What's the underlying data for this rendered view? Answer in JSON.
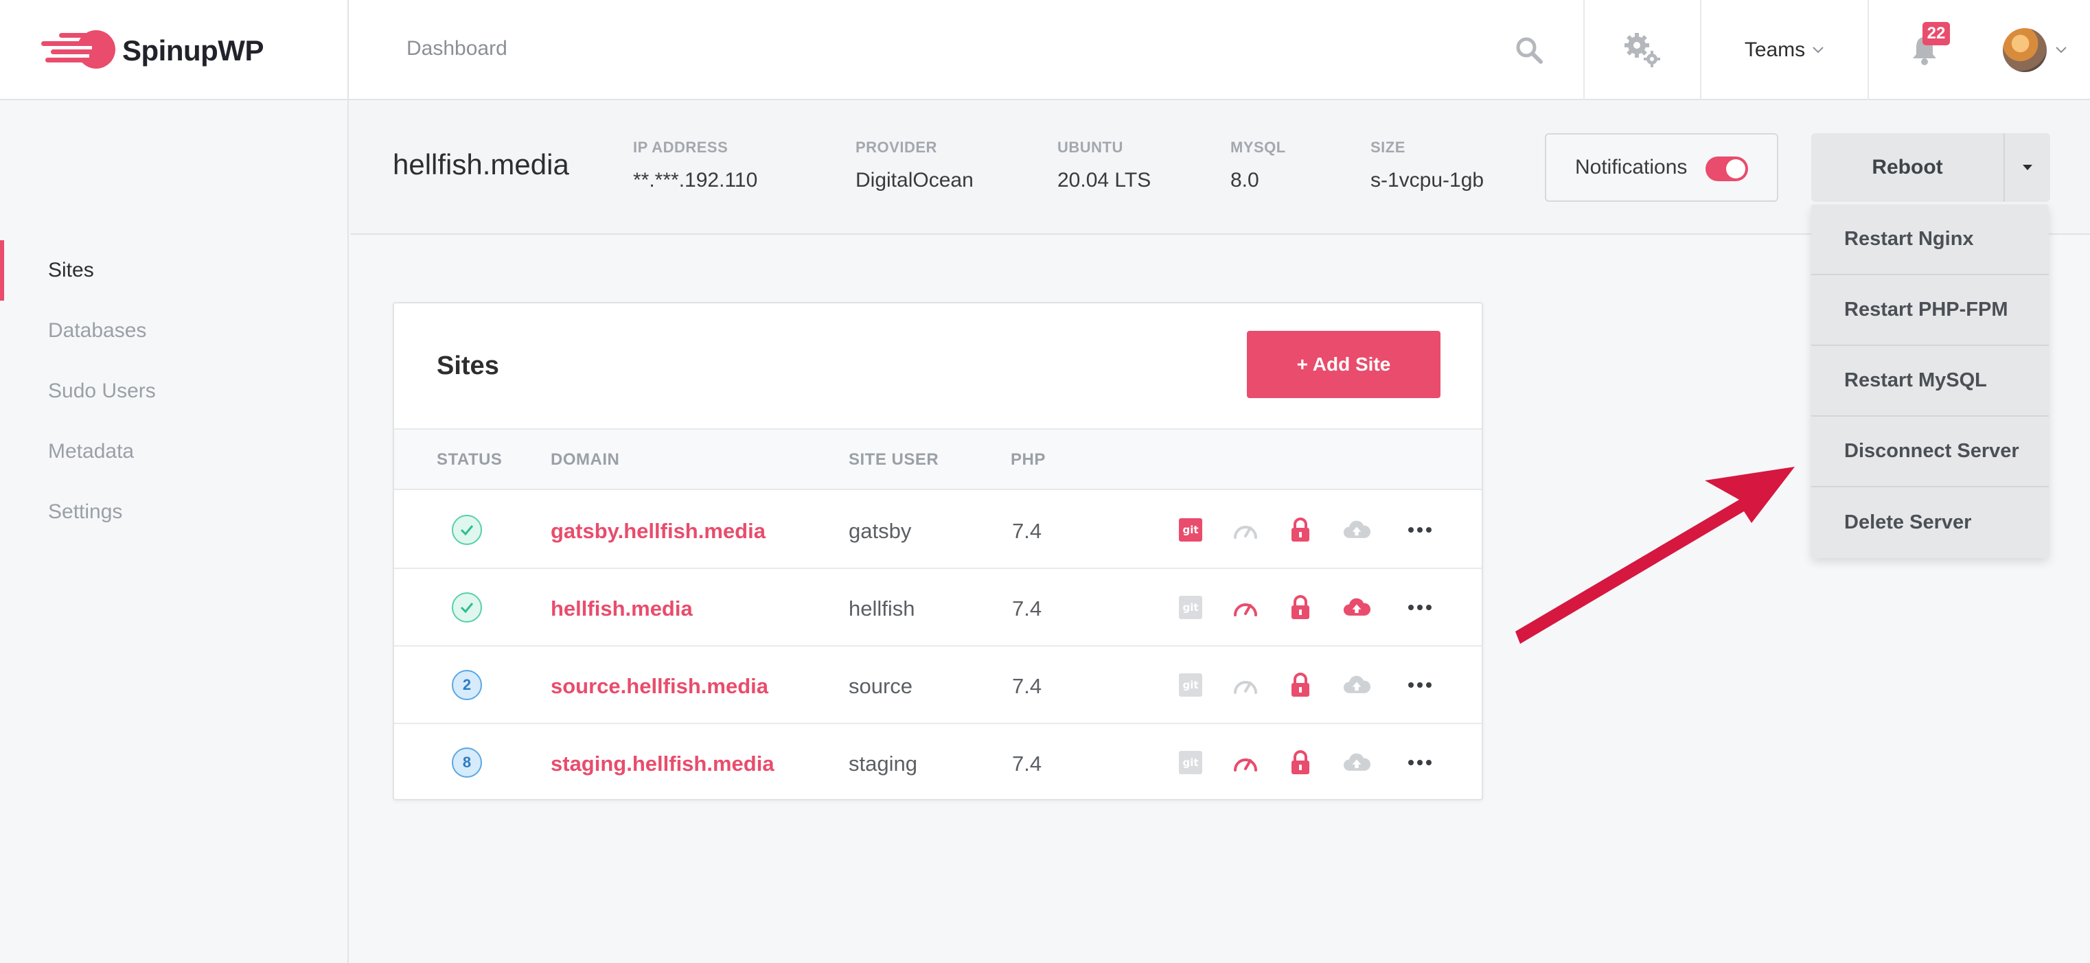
{
  "app": {
    "name": "SpinupWP",
    "brand_color": "#e94c6c"
  },
  "topbar": {
    "breadcrumb": "Dashboard",
    "teams_label": "Teams",
    "notification_count": "22"
  },
  "sidebar": {
    "items": [
      {
        "label": "Sites",
        "active": true
      },
      {
        "label": "Databases",
        "active": false
      },
      {
        "label": "Sudo Users",
        "active": false
      },
      {
        "label": "Metadata",
        "active": false
      },
      {
        "label": "Settings",
        "active": false
      }
    ]
  },
  "server": {
    "name": "hellfish.media",
    "meta": [
      {
        "key": "IP ADDRESS",
        "value": "**.***.192.110"
      },
      {
        "key": "PROVIDER",
        "value": "DigitalOcean"
      },
      {
        "key": "UBUNTU",
        "value": "20.04 LTS"
      },
      {
        "key": "MYSQL",
        "value": "8.0"
      },
      {
        "key": "SIZE",
        "value": "s-1vcpu-1gb"
      }
    ],
    "notifications_label": "Notifications",
    "notifications_on": true,
    "reboot_label": "Reboot",
    "dropdown": [
      "Restart Nginx",
      "Restart PHP-FPM",
      "Restart MySQL",
      "Disconnect Server",
      "Delete Server"
    ]
  },
  "sites": {
    "title": "Sites",
    "add_label": "+ Add Site",
    "columns": [
      "STATUS",
      "DOMAIN",
      "SITE USER",
      "PHP"
    ],
    "rows": [
      {
        "status": "check",
        "domain": "gatsby.hellfish.media",
        "user": "gatsby",
        "php": "7.4",
        "git": true,
        "perf": false,
        "ssl": true,
        "backup": false
      },
      {
        "status": "check",
        "domain": "hellfish.media",
        "user": "hellfish",
        "php": "7.4",
        "git": false,
        "perf": true,
        "ssl": true,
        "backup": true
      },
      {
        "status": "2",
        "domain": "source.hellfish.media",
        "user": "source",
        "php": "7.4",
        "git": false,
        "perf": false,
        "ssl": true,
        "backup": false
      },
      {
        "status": "8",
        "domain": "staging.hellfish.media",
        "user": "staging",
        "php": "7.4",
        "git": false,
        "perf": true,
        "ssl": true,
        "backup": false
      }
    ]
  }
}
